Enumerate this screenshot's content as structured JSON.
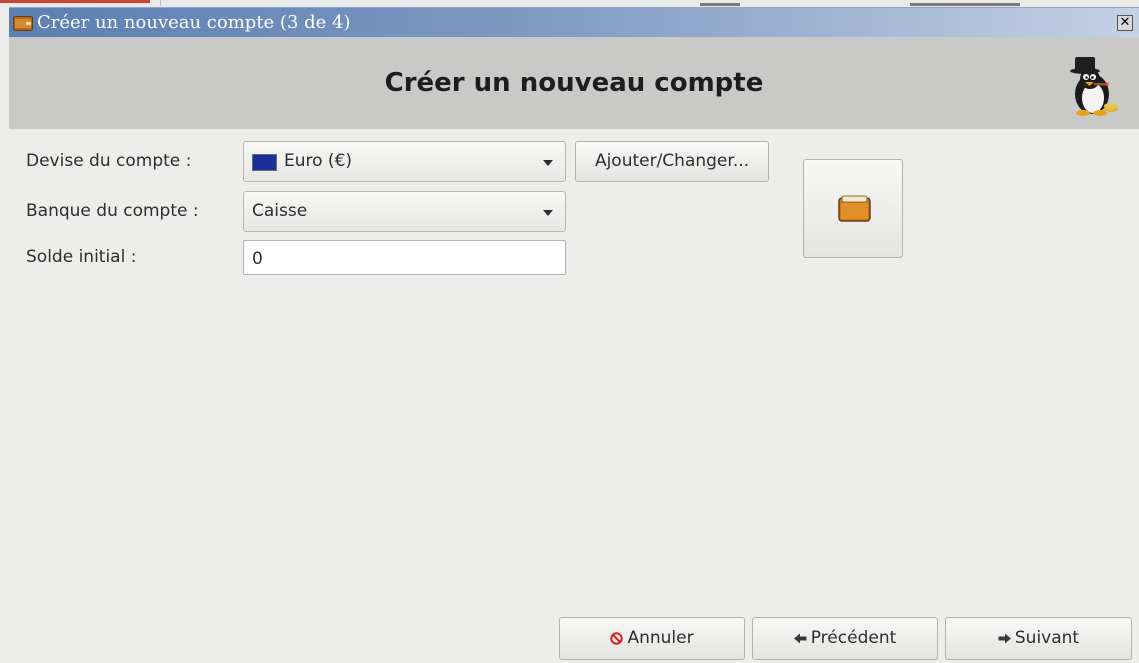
{
  "window": {
    "title": "Créer un nouveau compte (3 de 4)",
    "close_label": "✕"
  },
  "header": {
    "heading": "Créer un nouveau compte"
  },
  "form": {
    "currency_label": "Devise du compte :",
    "currency_value": "Euro (€)",
    "bank_label": "Banque du compte :",
    "bank_value": "Caisse",
    "balance_label": "Solde initial :",
    "balance_value": "0",
    "add_change_label": "Ajouter/Changer..."
  },
  "footer": {
    "cancel_label": "Annuler",
    "previous_label": "Précédent",
    "next_label": "Suivant"
  },
  "icons": {
    "window": "wallet-icon",
    "logo": "penguin-mascot-icon",
    "account_type": "folder-wallet-icon",
    "currency_flag": "eu-flag-icon",
    "cancel": "stop-icon",
    "previous": "arrow-left-icon",
    "next": "arrow-right-icon"
  }
}
